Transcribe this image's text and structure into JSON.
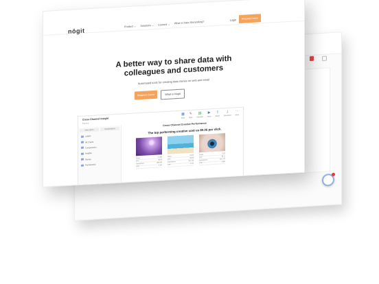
{
  "brand": {
    "logo": "nōgit",
    "accent": "#f5a25a"
  },
  "nav": {
    "links": [
      "Product ⌄",
      "Solutions ⌄",
      "Content ⌄",
      "What is Data Storytelling?"
    ],
    "login": "Login",
    "cta": "Request Demo"
  },
  "hero": {
    "headline_line1": "A better way to share data with",
    "headline_line2": "colleagues and customers",
    "subline": "Automated tools for creating data stories on web and email",
    "primary_button": "Request Demo",
    "secondary_button": "What is Nugit"
  },
  "app": {
    "title": "Cross Channel Insight",
    "subtitle": "Bounce",
    "toolbar": [
      {
        "icon": "table-icon",
        "label": "Data"
      },
      {
        "icon": "pin-icon",
        "label": "Style"
      },
      {
        "icon": "chart-icon",
        "label": "Visualise"
      },
      {
        "icon": "play-icon",
        "label": "Story"
      },
      {
        "icon": "share-icon",
        "label": "Share"
      },
      {
        "icon": "download-icon",
        "label": "Download"
      },
      {
        "icon": "more-icon",
        "label": "More"
      }
    ],
    "sidebar_tabs": [
      "Story Items",
      "Visualisations"
    ],
    "sidebar_items": [
      "Labels",
      "All Charts",
      "Comparisons",
      "Insights",
      "Stories",
      "Frameworks"
    ],
    "report_title": "Cross Channel Creative Performance",
    "report_heading": "The top performing creative cost us $0.06 per click.",
    "cards": [
      {
        "image": "purple-abstract",
        "rows": [
          [
            "Clicks",
            "12,483"
          ],
          [
            "CPC",
            "$0.06"
          ],
          [
            "Impressions",
            "298,344"
          ],
          [
            "CTR",
            "4.2%"
          ]
        ]
      },
      {
        "image": "beach-runner",
        "rows": [
          [
            "Clicks",
            "9,870"
          ],
          [
            "CPC",
            "$0.08"
          ],
          [
            "Impressions",
            "240,118"
          ],
          [
            "CTR",
            "4.1%"
          ]
        ]
      },
      {
        "image": "eye-closeup",
        "rows": [
          [
            "Clicks",
            "7,215"
          ],
          [
            "CPC",
            "$0.11"
          ],
          [
            "Impressions",
            "201,775"
          ],
          [
            "CTR",
            "3.6%"
          ]
        ]
      }
    ]
  }
}
